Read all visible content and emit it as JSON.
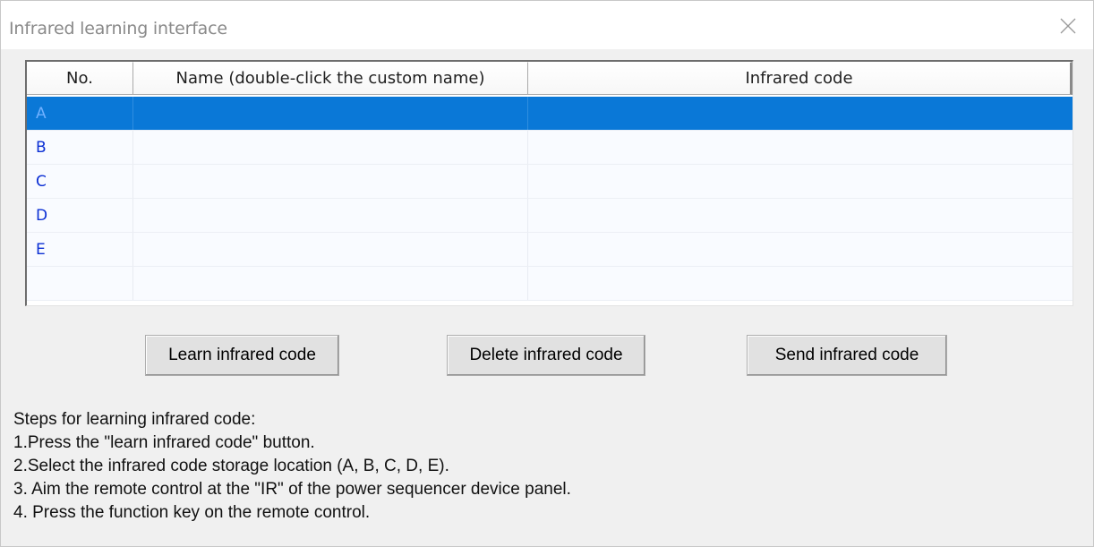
{
  "window": {
    "title": "Infrared learning interface",
    "close_icon": "close-icon"
  },
  "table": {
    "columns": [
      "No.",
      "Name (double-click the custom name)",
      "Infrared code"
    ],
    "rows": [
      {
        "no": "A",
        "name": "",
        "code": "",
        "selected": true
      },
      {
        "no": "B",
        "name": "",
        "code": "",
        "selected": false
      },
      {
        "no": "C",
        "name": "",
        "code": "",
        "selected": false
      },
      {
        "no": "D",
        "name": "",
        "code": "",
        "selected": false
      },
      {
        "no": "E",
        "name": "",
        "code": "",
        "selected": false
      }
    ],
    "selection_color": "#0a78d7",
    "row_text_color": "#0b2fd4"
  },
  "buttons": {
    "learn": "Learn infrared code",
    "delete": "Delete infrared code",
    "send": "Send infrared code"
  },
  "steps": {
    "heading": "Steps for learning infrared code:",
    "lines": [
      "1.Press the \"learn infrared code\" button.",
      "2.Select the infrared code storage location (A, B, C, D, E).",
      "3. Aim the remote control at the \"IR\" of the power sequencer device panel.",
      "4. Press the function key on the remote control."
    ]
  }
}
